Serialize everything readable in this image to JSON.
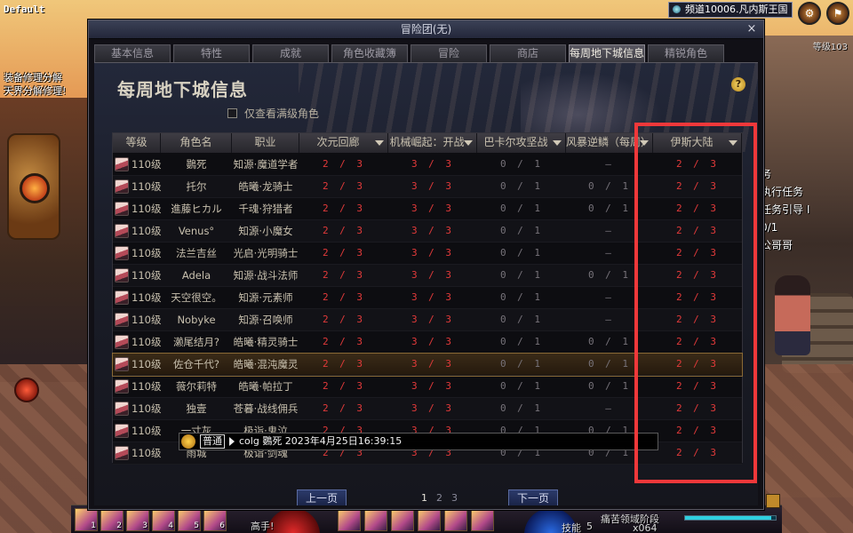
{
  "hud": {
    "profile_label": "Default",
    "channel": "频道10006.凡内斯王国",
    "left_notes": [
      "装备修理分解",
      "天界分解修理!"
    ],
    "right_top_text": "等级103",
    "quest_lines": [
      "务",
      "执行任务",
      "任务引导 I",
      "0/1",
      "公哥哥"
    ],
    "hotbar_text_name": "高手!",
    "hotbar_text_right": "痛苦领域阶段",
    "hotbar_skill_label": "技能",
    "hotbar_skill_points": "5",
    "hotbar_count": "x064",
    "skill_keys": [
      "1",
      "2",
      "3",
      "4",
      "5",
      "6"
    ],
    "bottom_bar_fill": 0.95
  },
  "window": {
    "title": "冒险团(无)",
    "close_label": "×",
    "tabs": [
      {
        "label": "基本信息"
      },
      {
        "label": "特性"
      },
      {
        "label": "成就"
      },
      {
        "label": "角色收藏簿"
      },
      {
        "label": "冒险"
      },
      {
        "label": "商店"
      },
      {
        "label": "每周地下城信息",
        "active": true
      },
      {
        "label": "精锐角色"
      }
    ],
    "page_title": "每周地下城信息",
    "help_label": "?",
    "filter_label": "仅查看满级角色"
  },
  "table": {
    "headers": {
      "level": "等级",
      "name": "角色名",
      "job": "职业",
      "d1": "次元回廊",
      "d2": "机械崛起：开战",
      "d3": "巴卡尔攻坚战",
      "d4": "风暴逆鳞（每周）",
      "d5": "伊斯大陆"
    },
    "rows": [
      {
        "level": "110级",
        "name": "鷃死",
        "job": "知源·魔道学者",
        "d1": "2/3",
        "d2": "3/3",
        "d3": "0/1",
        "d4": "–",
        "d5": "2/3"
      },
      {
        "level": "110级",
        "name": "托尔",
        "job": "皓曦·龙骑士",
        "d1": "2/3",
        "d2": "3/3",
        "d3": "0/1",
        "d4": "0/1",
        "d5": "2/3"
      },
      {
        "level": "110级",
        "name": "進藤ヒカル",
        "job": "千魂·狩猎者",
        "d1": "2/3",
        "d2": "3/3",
        "d3": "0/1",
        "d4": "0/1",
        "d5": "2/3"
      },
      {
        "level": "110级",
        "name": "Venus°",
        "job": "知源·小魔女",
        "d1": "2/3",
        "d2": "3/3",
        "d3": "0/1",
        "d4": "–",
        "d5": "2/3"
      },
      {
        "level": "110级",
        "name": "法兰吉丝",
        "job": "光启·光明骑士",
        "d1": "2/3",
        "d2": "3/3",
        "d3": "0/1",
        "d4": "–",
        "d5": "2/3"
      },
      {
        "level": "110级",
        "name": "Adela",
        "job": "知源·战斗法师",
        "d1": "2/3",
        "d2": "3/3",
        "d3": "0/1",
        "d4": "0/1",
        "d5": "2/3"
      },
      {
        "level": "110级",
        "name": "天空很空。",
        "job": "知源·元素师",
        "d1": "2/3",
        "d2": "3/3",
        "d3": "0/1",
        "d4": "–",
        "d5": "2/3"
      },
      {
        "level": "110级",
        "name": "Nobyke",
        "job": "知源·召唤师",
        "d1": "2/3",
        "d2": "3/3",
        "d3": "0/1",
        "d4": "–",
        "d5": "2/3"
      },
      {
        "level": "110级",
        "name": "濑尾结月?",
        "job": "皓曦·精灵骑士",
        "d1": "2/3",
        "d2": "3/3",
        "d3": "0/1",
        "d4": "0/1",
        "d5": "2/3"
      },
      {
        "level": "110级",
        "name": "佐仓千代?",
        "job": "皓曦·混沌魔灵",
        "d1": "2/3",
        "d2": "3/3",
        "d3": "0/1",
        "d4": "0/1",
        "d5": "2/3",
        "selected": true
      },
      {
        "level": "110级",
        "name": "薇尔莉特",
        "job": "皓曦·帕拉丁",
        "d1": "2/3",
        "d2": "3/3",
        "d3": "0/1",
        "d4": "0/1",
        "d5": "2/3"
      },
      {
        "level": "110级",
        "name": "独壹",
        "job": "苍暮·战线佣兵",
        "d1": "2/3",
        "d2": "3/3",
        "d3": "0/1",
        "d4": "–",
        "d5": "2/3"
      },
      {
        "level": "110级",
        "name": "一寸灰",
        "job": "极诣·鬼泣",
        "d1": "2/3",
        "d2": "3/3",
        "d3": "0/1",
        "d4": "0/1",
        "d5": "2/3"
      },
      {
        "level": "110级",
        "name": "雨城",
        "job": "极诣·剑魂",
        "d1": "2/3",
        "d2": "3/3",
        "d3": "0/1",
        "d4": "0/1",
        "d5": "2/3"
      }
    ]
  },
  "pager": {
    "prev_label": "上一页",
    "next_label": "下一页",
    "pages": [
      "1",
      "2",
      "3"
    ],
    "current_page": "1"
  },
  "chat": {
    "channel": "普通",
    "message": "colg 鷃死 2023年4月25日16:39:15"
  },
  "colors": {
    "highlight": "#f0383a",
    "progress_red": "#e23a3a",
    "progress_gray": "#77737a"
  }
}
